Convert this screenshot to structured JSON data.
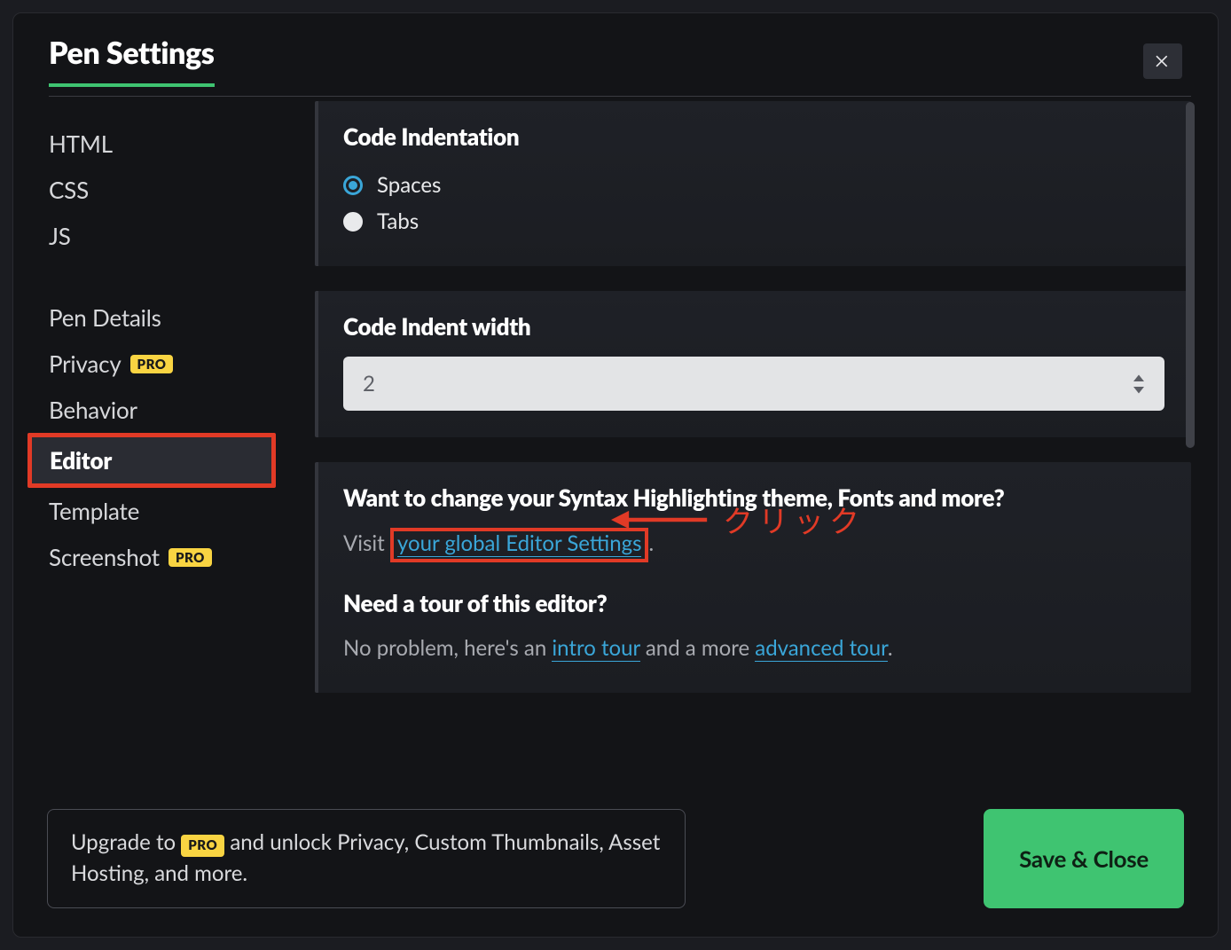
{
  "header": {
    "title": "Pen Settings"
  },
  "sidebar": {
    "group1": [
      "HTML",
      "CSS",
      "JS"
    ],
    "group2": [
      {
        "label": "Pen Details",
        "pro": false
      },
      {
        "label": "Privacy",
        "pro": true
      },
      {
        "label": "Behavior",
        "pro": false
      },
      {
        "label": "Editor",
        "pro": false,
        "active": true
      },
      {
        "label": "Template",
        "pro": false
      },
      {
        "label": "Screenshot",
        "pro": true
      }
    ],
    "pro_label": "PRO"
  },
  "panels": {
    "indentation": {
      "heading": "Code Indentation",
      "options": {
        "spaces": "Spaces",
        "tabs": "Tabs"
      },
      "selected": "spaces"
    },
    "indent_width": {
      "heading": "Code Indent width",
      "value": "2"
    },
    "more": {
      "heading": "Want to change your Syntax Highlighting theme, Fonts and more?",
      "visit_prefix": "Visit ",
      "visit_link": "your global Editor Settings",
      "visit_suffix": ".",
      "tour_heading": "Need a tour of this editor?",
      "tour_prefix": "No problem, here's an ",
      "tour_link1": "intro tour",
      "tour_mid": " and a more ",
      "tour_link2": "advanced tour",
      "tour_suffix": "."
    }
  },
  "annotation": {
    "text": "クリック"
  },
  "footer": {
    "upgrade_a": "Upgrade to ",
    "upgrade_b": " and unlock Privacy, Custom Thumbnails, Asset Hosting, and more.",
    "save": "Save & Close"
  }
}
